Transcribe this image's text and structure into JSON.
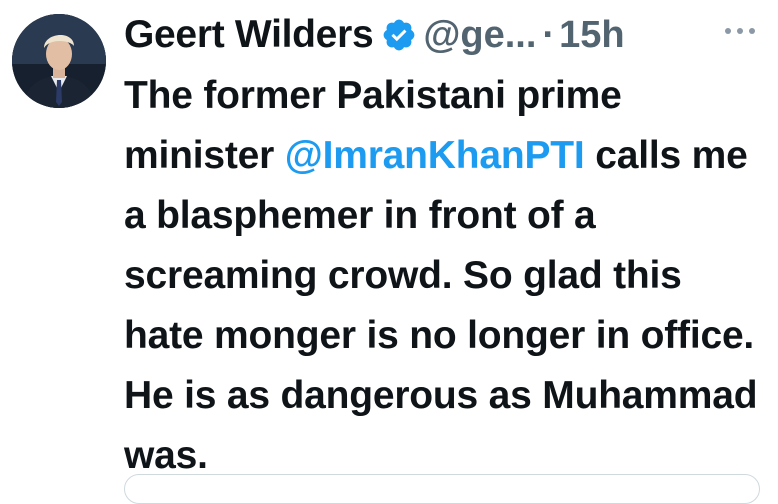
{
  "tweet": {
    "author_name": "Geert Wilders",
    "handle": "@ge...",
    "dot": "·",
    "time": "15h",
    "text_before_mention": "The former Pakistani prime minister ",
    "mention": "@ImranKhanPTI",
    "text_after_mention": " calls me a blasphemer in front of a screaming crowd. So glad this hate monger is no longer in office. He is as dangerous as Muhammad was."
  },
  "icons": {
    "verified": "verified-badge-icon",
    "more": "more-options-icon"
  },
  "colors": {
    "text": "#0f1419",
    "secondary": "#536471",
    "link": "#1d9bf0",
    "verified": "#1d9bf0"
  }
}
